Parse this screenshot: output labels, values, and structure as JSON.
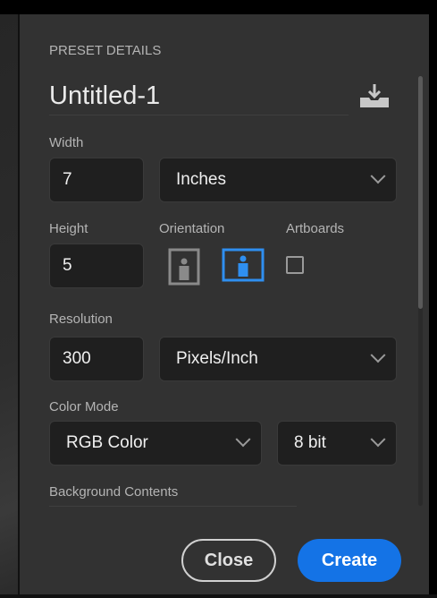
{
  "section_header": "PRESET DETAILS",
  "document_name": "Untitled-1",
  "width": {
    "label": "Width",
    "value": "7",
    "unit": "Inches"
  },
  "height": {
    "label": "Height",
    "value": "5"
  },
  "orientation": {
    "label": "Orientation",
    "selected": "landscape"
  },
  "artboards": {
    "label": "Artboards",
    "checked": false
  },
  "resolution": {
    "label": "Resolution",
    "value": "300",
    "unit": "Pixels/Inch"
  },
  "color_mode": {
    "label": "Color Mode",
    "mode": "RGB Color",
    "depth": "8 bit"
  },
  "background": {
    "label": "Background Contents"
  },
  "buttons": {
    "close": "Close",
    "create": "Create"
  },
  "colors": {
    "accent": "#1473e6",
    "panel": "#323232",
    "field": "#1f1f1f"
  }
}
